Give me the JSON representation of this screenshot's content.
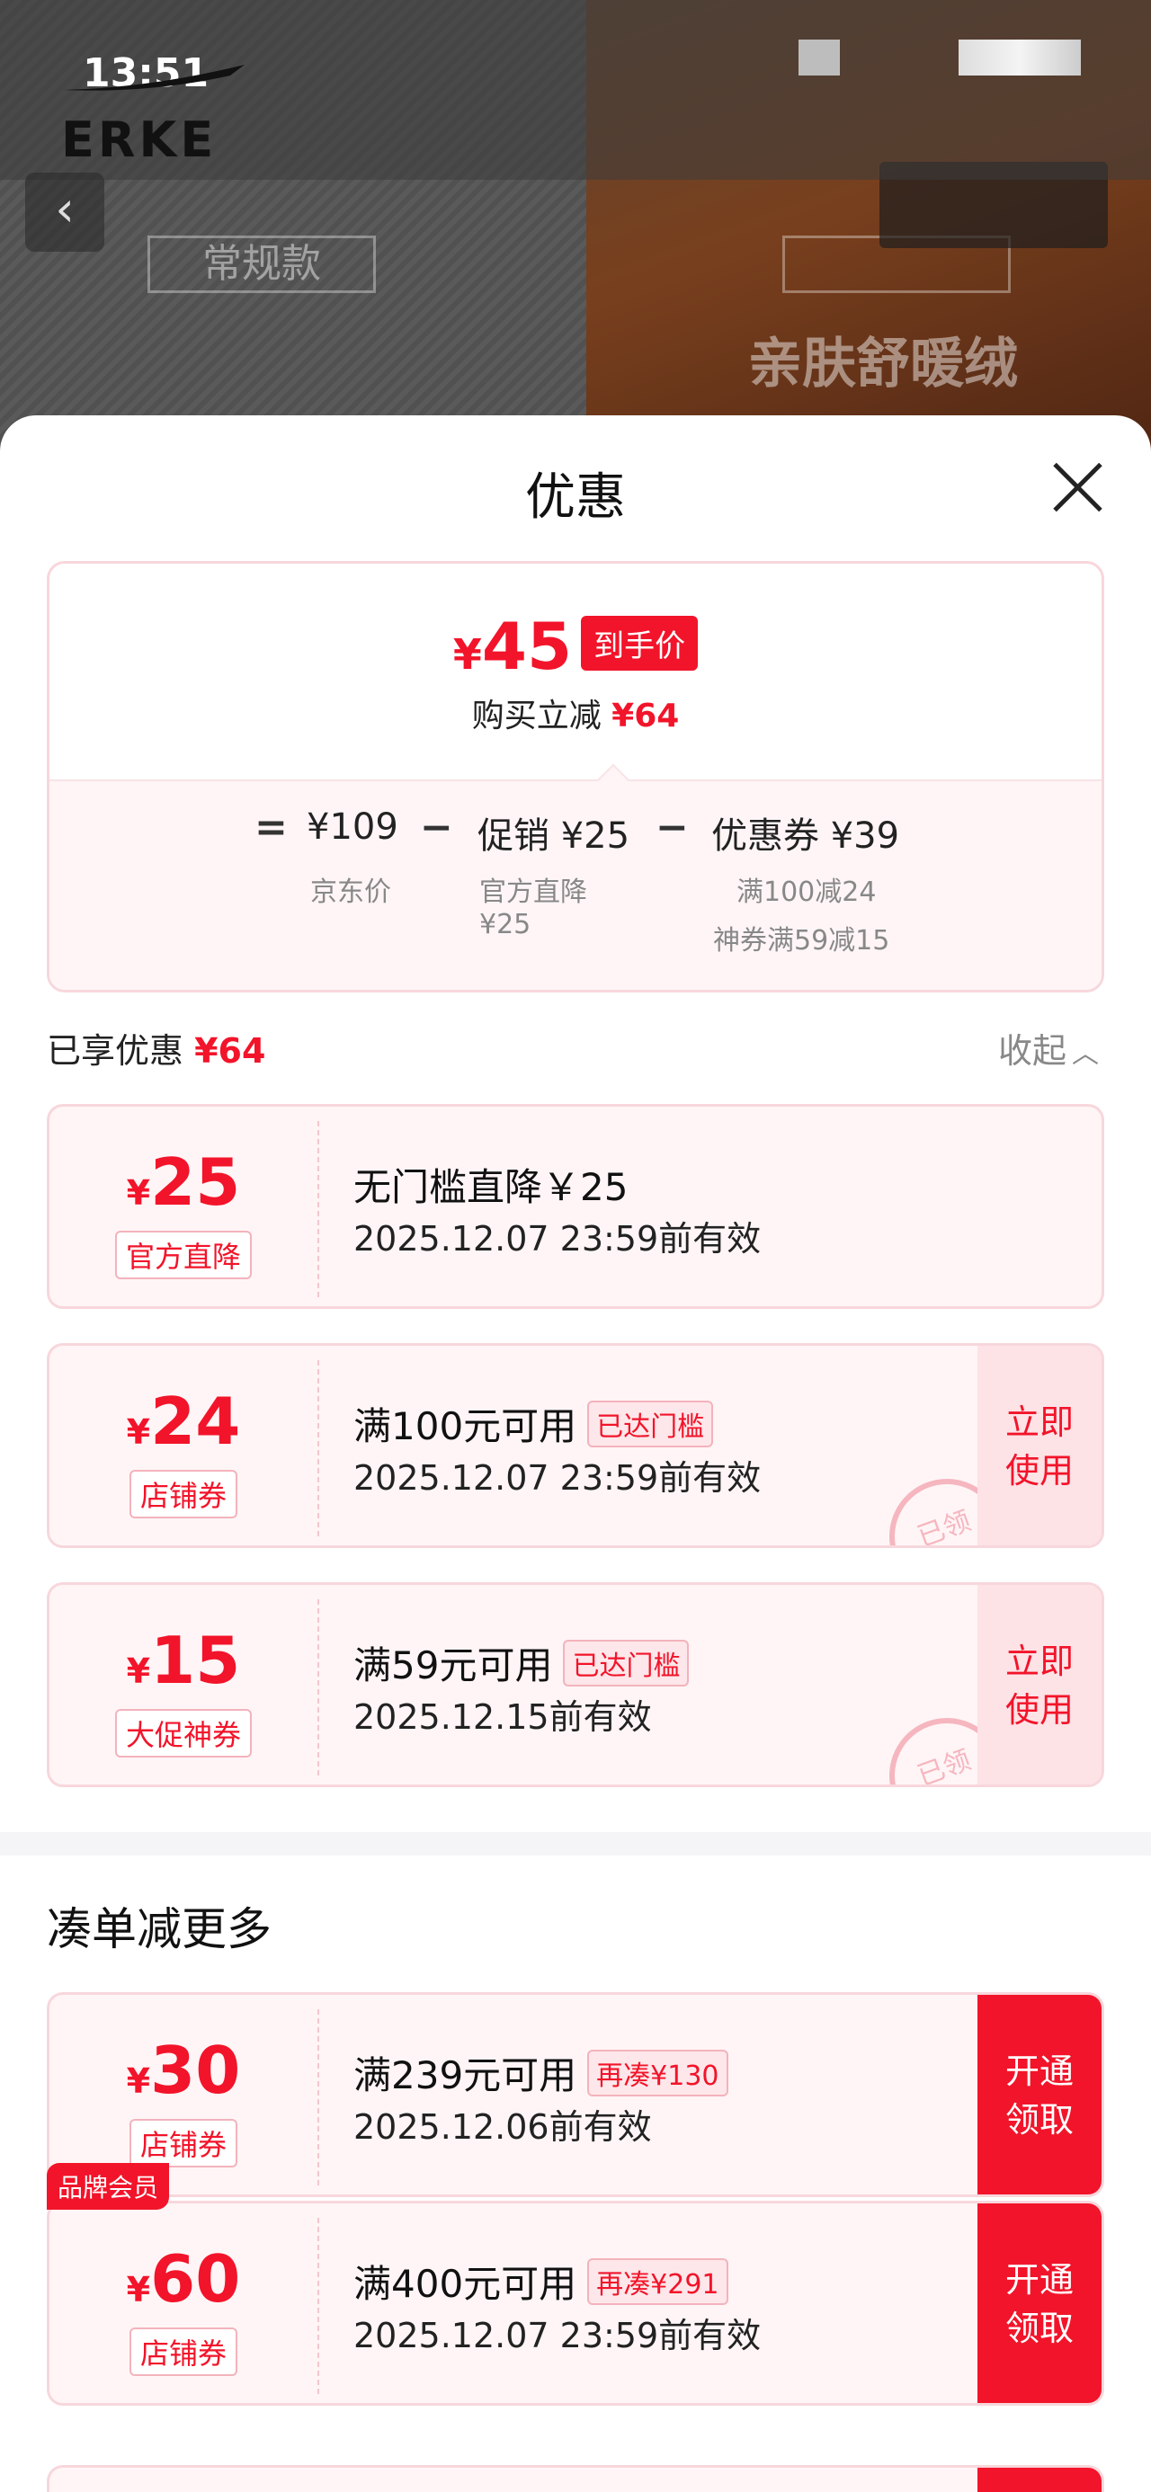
{
  "status_bar": {
    "time": "13:51"
  },
  "brand": {
    "logo_text": "ERKE"
  },
  "background": {
    "tag_left": "常规款",
    "tag_right_title": "亲肤舒暖绒"
  },
  "sheet": {
    "title": "优惠",
    "summary": {
      "currency": "¥",
      "final_price": "45",
      "final_badge": "到手价",
      "instant_label": "购买立减",
      "instant_value": "¥64",
      "equals": "=",
      "jd_price": "¥109",
      "jd_label": "京东价",
      "minus1": "−",
      "promo": "促销 ¥25",
      "promo_sub1": "官方直降",
      "promo_sub2": "¥25",
      "minus2": "−",
      "coupon": "优惠券 ¥39",
      "coupon_sub1": "满100减24",
      "coupon_sub2": "神券满59减15"
    },
    "enjoyed": {
      "label": "已享优惠",
      "value": "¥64",
      "collapse": "收起"
    },
    "coupons": [
      {
        "yen": "¥",
        "amount": "25",
        "type": "官方直降",
        "title": "无门槛直降￥25",
        "tag": "",
        "valid": "2025.12.07 23:59前有效",
        "action": ""
      },
      {
        "yen": "¥",
        "amount": "24",
        "type": "店铺券",
        "title": "满100元可用",
        "tag": "已达门槛",
        "valid": "2025.12.07 23:59前有效",
        "action": "立即使用",
        "stamp": "已领"
      },
      {
        "yen": "¥",
        "amount": "15",
        "type": "大促神券",
        "title": "满59元可用",
        "tag": "已达门槛",
        "valid": "2025.12.15前有效",
        "action": "立即使用",
        "stamp": "已领"
      }
    ],
    "more": {
      "title": "凑单减更多",
      "coupons": [
        {
          "yen": "¥",
          "amount": "30",
          "type": "店铺券",
          "title": "满239元可用",
          "tag": "再凑¥130",
          "valid": "2025.12.06前有效",
          "action": "开通领取"
        },
        {
          "yen": "¥",
          "amount": "60",
          "type": "店铺券",
          "title": "满400元可用",
          "tag": "再凑¥291",
          "valid": "2025.12.07 23:59前有效",
          "action": "开通领取",
          "badge": "品牌会员"
        }
      ]
    }
  },
  "colors": {
    "accent": "#f2142a",
    "card_border": "#f7d7dc",
    "card_bg": "#fff5f6"
  }
}
